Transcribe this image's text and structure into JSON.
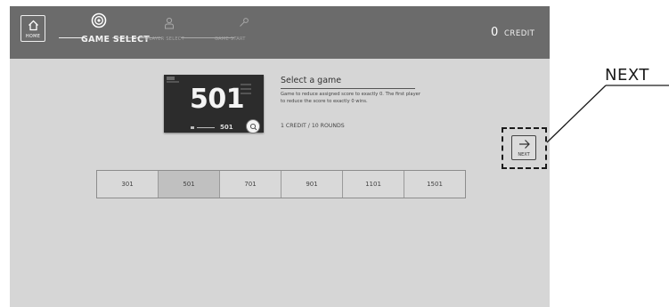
{
  "header": {
    "home_label": "HOME",
    "steps": [
      {
        "label": "GAME SELECT",
        "icon": "target-icon",
        "state": "active"
      },
      {
        "label": "PLAYER SELECT",
        "icon": "person-icon",
        "state": "inactive"
      },
      {
        "label": "GAME START",
        "icon": "dart-icon",
        "state": "inactive"
      }
    ],
    "credit_count": "0",
    "credit_label": "CREDIT"
  },
  "preview": {
    "number": "501",
    "score": "501",
    "zoom_icon": "magnifier-icon"
  },
  "description": {
    "title": "Select a game",
    "text": "Game to reduce assigned score to exactly 0. The first player to reduce the score to exactly 0 wins.",
    "rounds": "1 CREDIT / 10 ROUNDS"
  },
  "game_options": [
    {
      "label": "301",
      "selected": false
    },
    {
      "label": "501",
      "selected": true
    },
    {
      "label": "701",
      "selected": false
    },
    {
      "label": "901",
      "selected": false
    },
    {
      "label": "1101",
      "selected": false
    },
    {
      "label": "1501",
      "selected": false
    }
  ],
  "next_button": {
    "label": "NEXT",
    "icon": "arrow-right-icon"
  },
  "callout": {
    "label": "NEXT"
  },
  "colors": {
    "header_bg": "#6b6b6b",
    "screen_bg": "#d6d6d6",
    "selected_option": "#c0c0c0",
    "preview_bg": "#2c2c2c"
  }
}
